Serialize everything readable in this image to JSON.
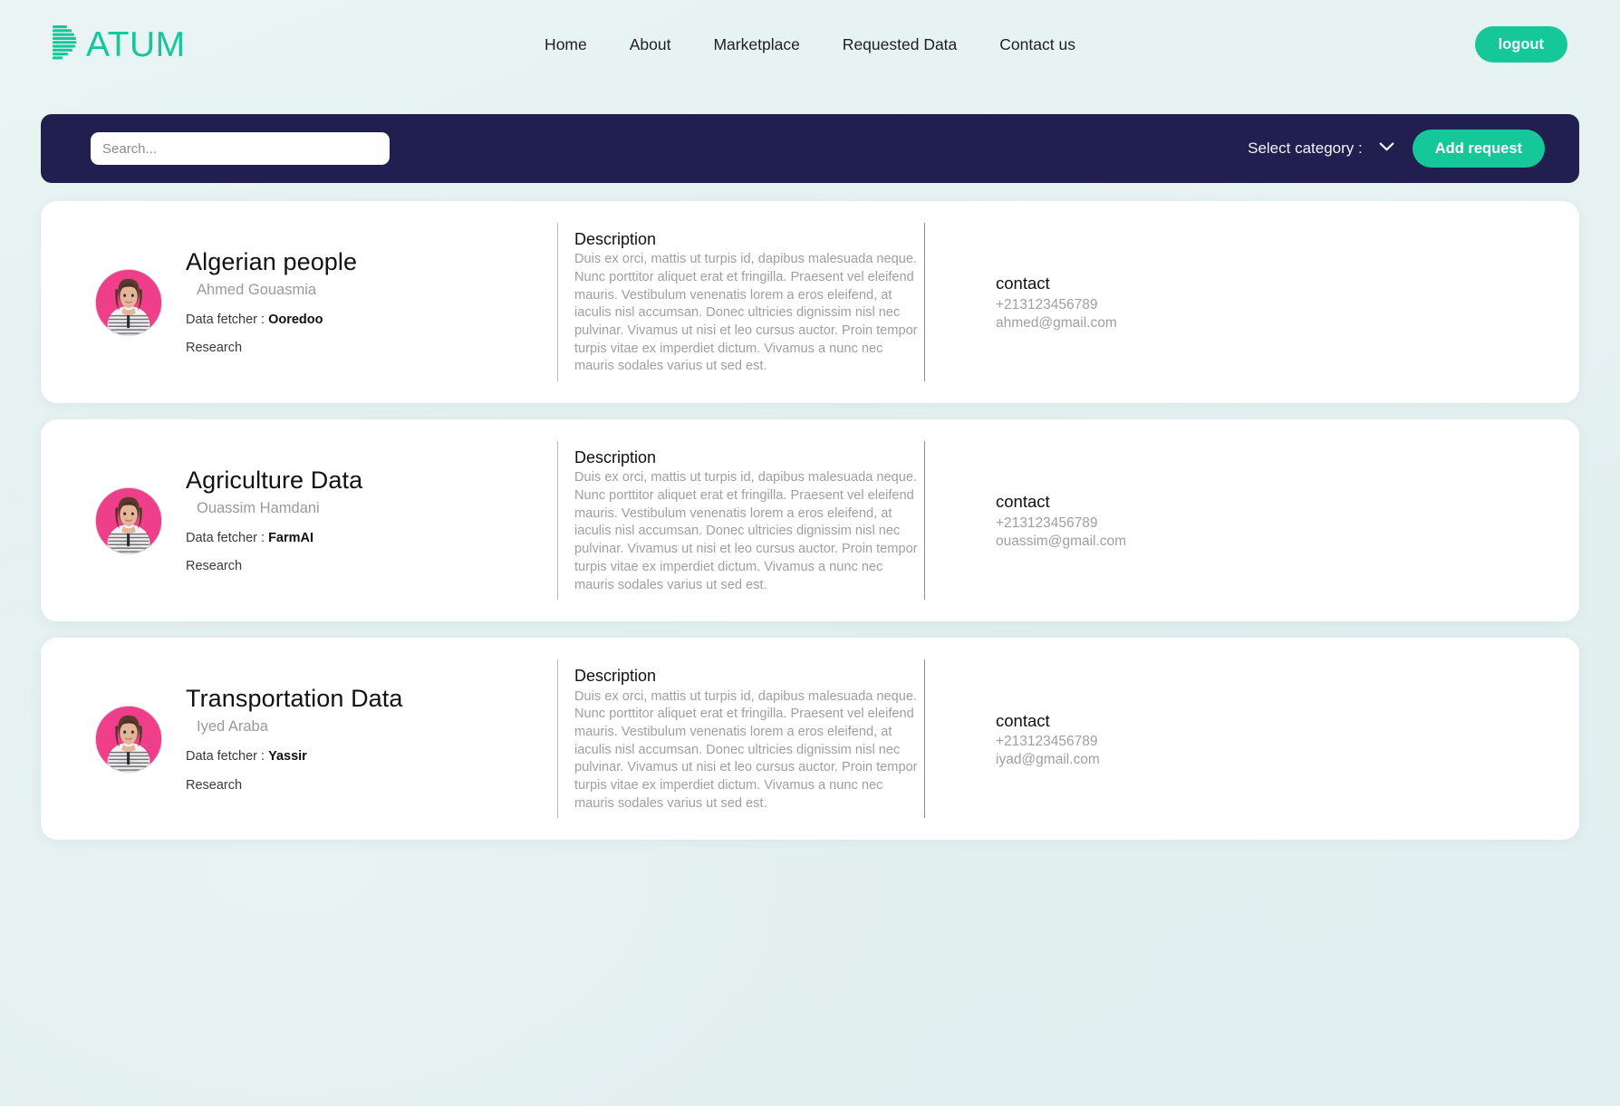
{
  "header": {
    "brand": {
      "mark_icon": "striped-d-logo-icon",
      "text": "ATUM",
      "full_name": "DATUM",
      "color": "#16c79a"
    },
    "nav": [
      {
        "label": "Home",
        "name": "home"
      },
      {
        "label": "About",
        "name": "about"
      },
      {
        "label": "Marketplace",
        "name": "marketplace"
      },
      {
        "label": "Requested Data",
        "name": "requested-data"
      },
      {
        "label": "Contact us",
        "name": "contact-us"
      }
    ],
    "logout_label": "logout"
  },
  "toolbar": {
    "search_placeholder": "Search...",
    "search_value": "",
    "category_label": "Select category :",
    "category_icon": "chevron-down-icon",
    "add_request_label": "Add request",
    "background_color": "#211f50",
    "accent_color": "#16c79a"
  },
  "labels": {
    "description_heading": "Description",
    "contact_heading": "contact",
    "fetcher_prefix": "Data fetcher : "
  },
  "cards": [
    {
      "title": "Algerian people",
      "owner": "Ahmed Gouasmia",
      "fetcher_label": "Data fetcher : ",
      "fetcher": "Ooredoo",
      "tag": "Research",
      "description_heading": "Description",
      "description": "Duis ex orci, mattis ut turpis id, dapibus malesuada neque. Nunc porttitor aliquet erat et fringilla. Praesent vel eleifend mauris. Vestibulum venenatis lorem a eros eleifend, at iaculis nisl accumsan. Donec ultricies dignissim nisl nec pulvinar. Vivamus ut nisi et leo cursus auctor. Proin tempor turpis vitae ex imperdiet dictum. Vivamus a nunc nec mauris sodales varius ut sed est.",
      "contact_heading": "contact",
      "phone": "+213123456789",
      "email": "ahmed@gmail.com",
      "avatar_icon": "user-avatar-photo"
    },
    {
      "title": "Agriculture Data",
      "owner": "Ouassim Hamdani",
      "fetcher_label": "Data fetcher : ",
      "fetcher": "FarmAI",
      "tag": "Research",
      "description_heading": "Description",
      "description": "Duis ex orci, mattis ut turpis id, dapibus malesuada neque. Nunc porttitor aliquet erat et fringilla. Praesent vel eleifend mauris. Vestibulum venenatis lorem a eros eleifend, at iaculis nisl accumsan. Donec ultricies dignissim nisl nec pulvinar. Vivamus ut nisi et leo cursus auctor. Proin tempor turpis vitae ex imperdiet dictum. Vivamus a nunc nec mauris sodales varius ut sed est.",
      "contact_heading": "contact",
      "phone": "+213123456789",
      "email": "ouassim@gmail.com",
      "avatar_icon": "user-avatar-photo"
    },
    {
      "title": "Transportation Data",
      "owner": "Iyed Araba",
      "fetcher_label": "Data fetcher : ",
      "fetcher": "Yassir",
      "tag": "Research",
      "description_heading": "Description",
      "description": "Duis ex orci, mattis ut turpis id, dapibus malesuada neque. Nunc porttitor aliquet erat et fringilla. Praesent vel eleifend mauris. Vestibulum venenatis lorem a eros eleifend, at iaculis nisl accumsan. Donec ultricies dignissim nisl nec pulvinar. Vivamus ut nisi et leo cursus auctor. Proin tempor turpis vitae ex imperdiet dictum. Vivamus a nunc nec mauris sodales varius ut sed est.",
      "contact_heading": "contact",
      "phone": "+213123456789",
      "email": "iyad@gmail.com",
      "avatar_icon": "user-avatar-photo"
    }
  ]
}
